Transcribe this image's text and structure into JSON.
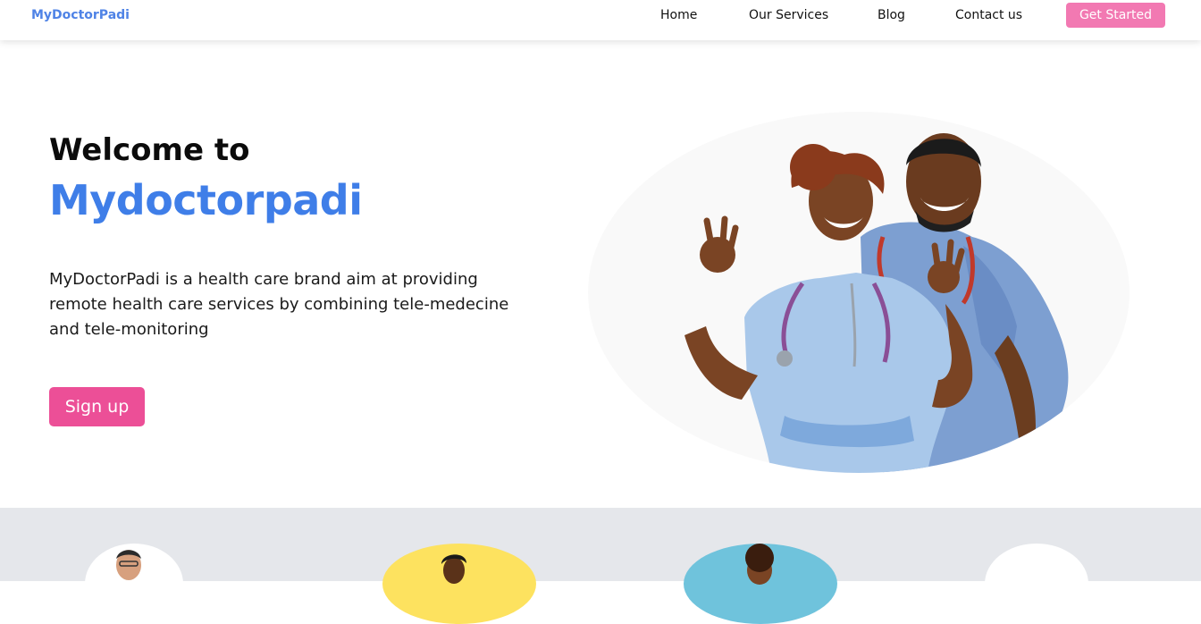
{
  "nav": {
    "brand": "MyDoctorPadi",
    "links": [
      "Home",
      "Our Services",
      "Blog",
      "Contact us"
    ],
    "cta": "Get Started"
  },
  "hero": {
    "eyebrow": "Welcome to",
    "title": "Mydoctorpadi",
    "description": "MyDoctorPadi is a health care brand aim at providing remote health care services by combining tele-medecine and tele-monitoring",
    "signup": "Sign up"
  },
  "colors": {
    "brand": "#4f83e6",
    "cta": "#f279b2",
    "signup": "#ec4f97",
    "title": "#3f7ee8",
    "band": "#e5e7eb"
  },
  "icons": [
    "doctors-image",
    "doctor-avatar-1",
    "doctor-avatar-2",
    "doctor-avatar-3",
    "doctor-avatar-4"
  ]
}
